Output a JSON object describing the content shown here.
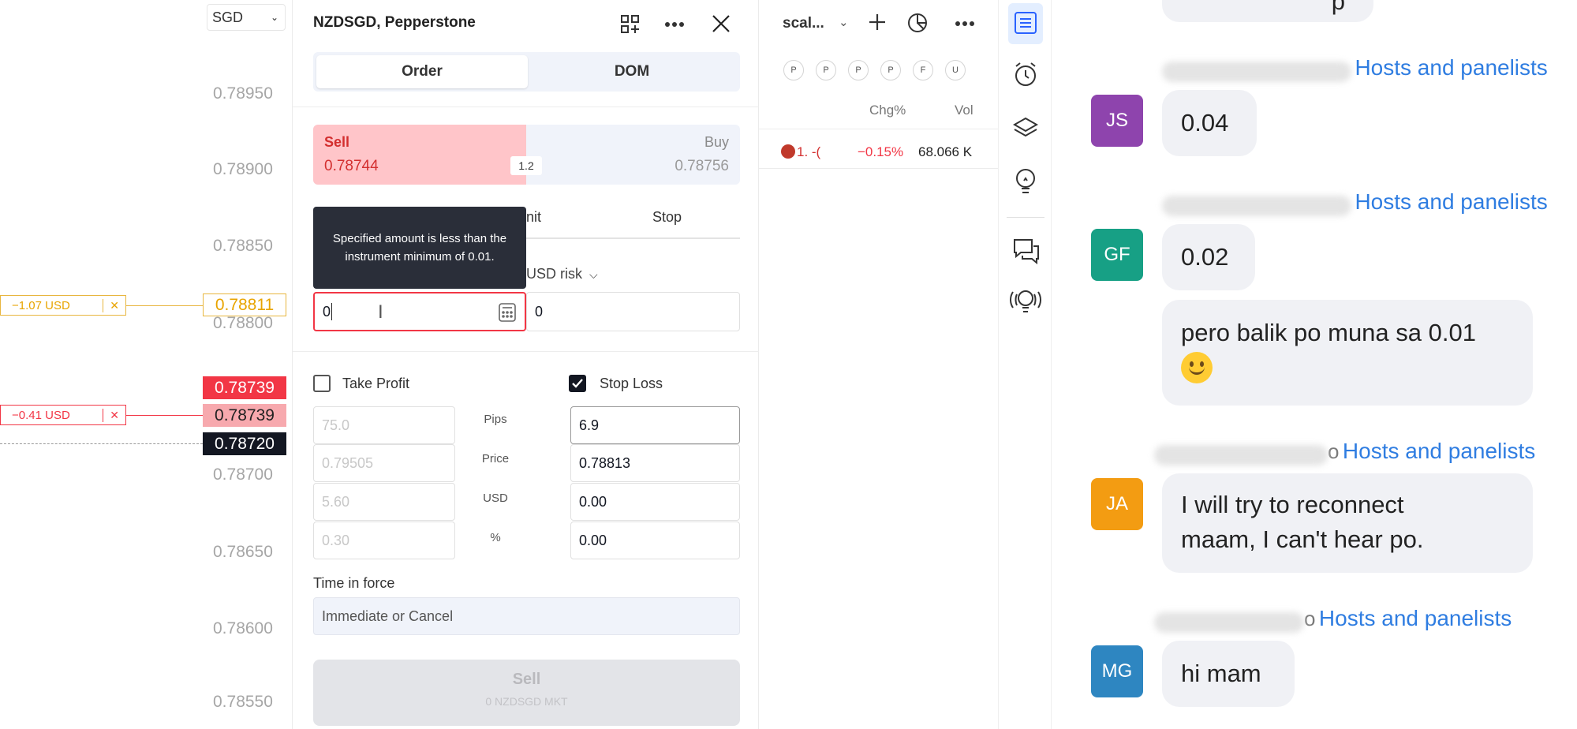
{
  "price_scale": {
    "currency": "SGD",
    "ticks": [
      "0.78950",
      "0.78900",
      "0.78850",
      "0.78800",
      "0.78700",
      "0.78650",
      "0.78600",
      "0.78550"
    ],
    "position_tags": [
      {
        "pnl": "−1.07 USD",
        "close": "✕",
        "price": "0.78811"
      },
      {
        "pnl": "−0.41 USD",
        "close": "✕",
        "price": "0.78739"
      }
    ],
    "sell_tag": "0.78739",
    "last_tag": "0.78720",
    "colors": {
      "sell": "#f23645",
      "sell_light": "#f7a9ae",
      "last": "#131722",
      "position": "#e8b63f",
      "loss": "#f23645"
    }
  },
  "order_panel": {
    "title": "NZDSGD, Pepperstone",
    "tabs": [
      "Order",
      "DOM"
    ],
    "sell_label": "Sell",
    "sell_price": "0.78744",
    "spread": "1.2",
    "buy_label": "Buy",
    "buy_price": "0.78756",
    "order_types": [
      "nit",
      "Stop"
    ],
    "tooltip": "Specified amount is less than the instrument minimum of 0.01.",
    "risk_label": "USD risk",
    "quantity_value": "0",
    "risk_value": "0",
    "take_profit": {
      "label": "Take Profit",
      "checked": false,
      "values": [
        "75.0",
        "0.79505",
        "5.60",
        "0.30"
      ]
    },
    "row_labels": [
      "Pips",
      "Price",
      "USD",
      "%"
    ],
    "stop_loss": {
      "label": "Stop Loss",
      "checked": true,
      "values": [
        "6.9",
        "0.78813",
        "0.00",
        "0.00"
      ]
    },
    "time_in_force_label": "Time in force",
    "time_in_force_value": "Immediate or Cancel",
    "submit_label": "Sell",
    "submit_sub": "0 NZDSGD MKT"
  },
  "watchlist": {
    "name": "scal...",
    "chips": [
      "P",
      "P",
      "P",
      "P",
      "F",
      "U"
    ],
    "headers": [
      "Chg%",
      "Vol"
    ],
    "rows": [
      {
        "symbol": "1. -(",
        "chg": "−0.15%",
        "vol": "68.066 K"
      }
    ]
  },
  "chat": {
    "partial_top": "p",
    "messages": [
      {
        "to": "Hosts and panelists",
        "initials": "JS",
        "color": "#8e44ad",
        "lines": [
          "0.04"
        ]
      },
      {
        "to": "Hosts and panelists",
        "initials": "GF",
        "color": "#17a085",
        "lines": [
          "0.02"
        ],
        "extra": "pero balik po muna sa 0.01"
      },
      {
        "prefix": "o",
        "to": "Hosts and panelists",
        "initials": "JA",
        "color": "#f39c12",
        "lines": [
          "I will try to reconnect",
          "maam, I can't hear po."
        ]
      },
      {
        "prefix": "o",
        "to": "Hosts and panelists",
        "initials": "MG",
        "color": "#2e86c1",
        "lines": [
          "hi mam"
        ]
      }
    ]
  }
}
